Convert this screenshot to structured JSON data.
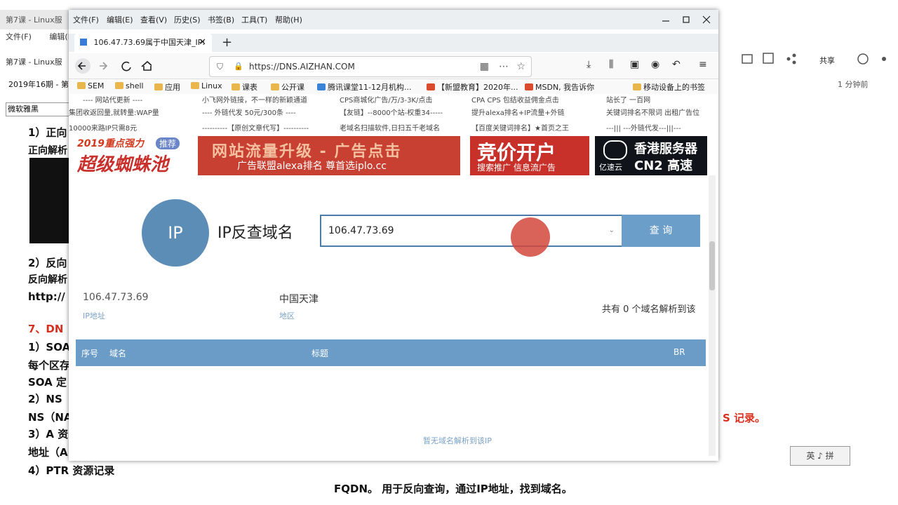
{
  "background_doc": {
    "tab": "第7课 - Linux服",
    "menu": [
      "文件(F)",
      "编辑(E)",
      "查看(V)"
    ],
    "doc_title": "第7课 - Linux服",
    "date_item": "2019年16期 - 第",
    "font_box": "微软雅黑",
    "lines": {
      "l1": "1）正向",
      "l2": "正向解析",
      "l3": "2）反向",
      "l4": "反向解析",
      "l5": "http://",
      "l6": "7、DN",
      "l7": "1）SOA",
      "l8": "每个区存",
      "l9": "SOA 定",
      "l10": "2）NS",
      "l11": "NS（NA",
      "l12": "3）A 资",
      "l13": "地址（A",
      "l14": "4）PTR 资源记录",
      "l15": "FQDN。 用于反向查询，通过IP地址，找到域名。"
    },
    "share_label": "共享",
    "time_label": "1 分钟前",
    "red_right": "S 记录。",
    "ime": "英 ♪ 拼"
  },
  "browser": {
    "menu": [
      "文件(F)",
      "编辑(E)",
      "查看(V)",
      "历史(S)",
      "书签(B)",
      "工具(T)",
      "帮助(H)"
    ],
    "tab_title": "106.47.73.69属于中国天津_IP:",
    "url": "https://DNS.AIZHAN.COM",
    "bookmarks": [
      "SEM",
      "shell",
      "应用",
      "Linux",
      "课表",
      "公开课",
      "腾讯课堂11-12月机构...",
      "【新盟教育】2020年...",
      "MSDN, 我告诉你",
      "移动设备上的书签"
    ],
    "ads": {
      "r1c1": "---- 网站代更新 ----",
      "r1c2": "小飞网外链接，不一样的新颖通道",
      "r1c3": "CPS商城化广告/万/3-3K/点击",
      "r1c4": "CPA CPS 包结收益佣金点击",
      "r1c5": "站长了 一百网",
      "r2c1": "集团收返回量,就转量:WAP量",
      "r2c2": "---- 外链代发 50元/300条 ----",
      "r2c3": "【友链】--8000个站-权重34-----",
      "r2c4": "提升alexa排名+IP流量+外链",
      "r2c5": "关键词排名不限词 出租广告位",
      "r3c1": "10000来路IP只需8元",
      "r3c2": "----------【原创文章代写】----------",
      "r3c3": "老域名扫描软件,日扫五千老域名",
      "r3c4": "【百度关键词排名】★首页之王",
      "r3c5": "---||| ---外链代发---|||---"
    },
    "banners": {
      "b1_top": "2019重点强力",
      "b1_badge": "推荐",
      "b1_main": "超级蜘蛛池",
      "b2_main": "网站流量升级 - 广告点击",
      "b2_sub": "广告联盟alexa排名 尊首选iplo.cc",
      "b3_main": "竞价开户",
      "b3_sub": "搜索推广 信息流广告",
      "b4_brand": "亿速云",
      "b4_main": "香港服务器",
      "b4_sub": "CN2 高速"
    },
    "search": {
      "circle_text": "IP",
      "title": "IP反查域名",
      "input_value": "106.47.73.69",
      "button": "查 询"
    },
    "result": {
      "ip": "106.47.73.69",
      "ip_label": "IP地址",
      "location": "中国天津",
      "location_label": "地区",
      "count": "共有 0 个域名解析到该"
    },
    "table": {
      "headers": [
        "序号",
        "域名",
        "标题",
        "BR"
      ]
    },
    "empty_message": "暂无域名解析到该IP"
  },
  "colors": {
    "accent_blue": "#6a9cc7",
    "circle_blue": "#5b8db7",
    "doc_red": "#d9301e"
  }
}
